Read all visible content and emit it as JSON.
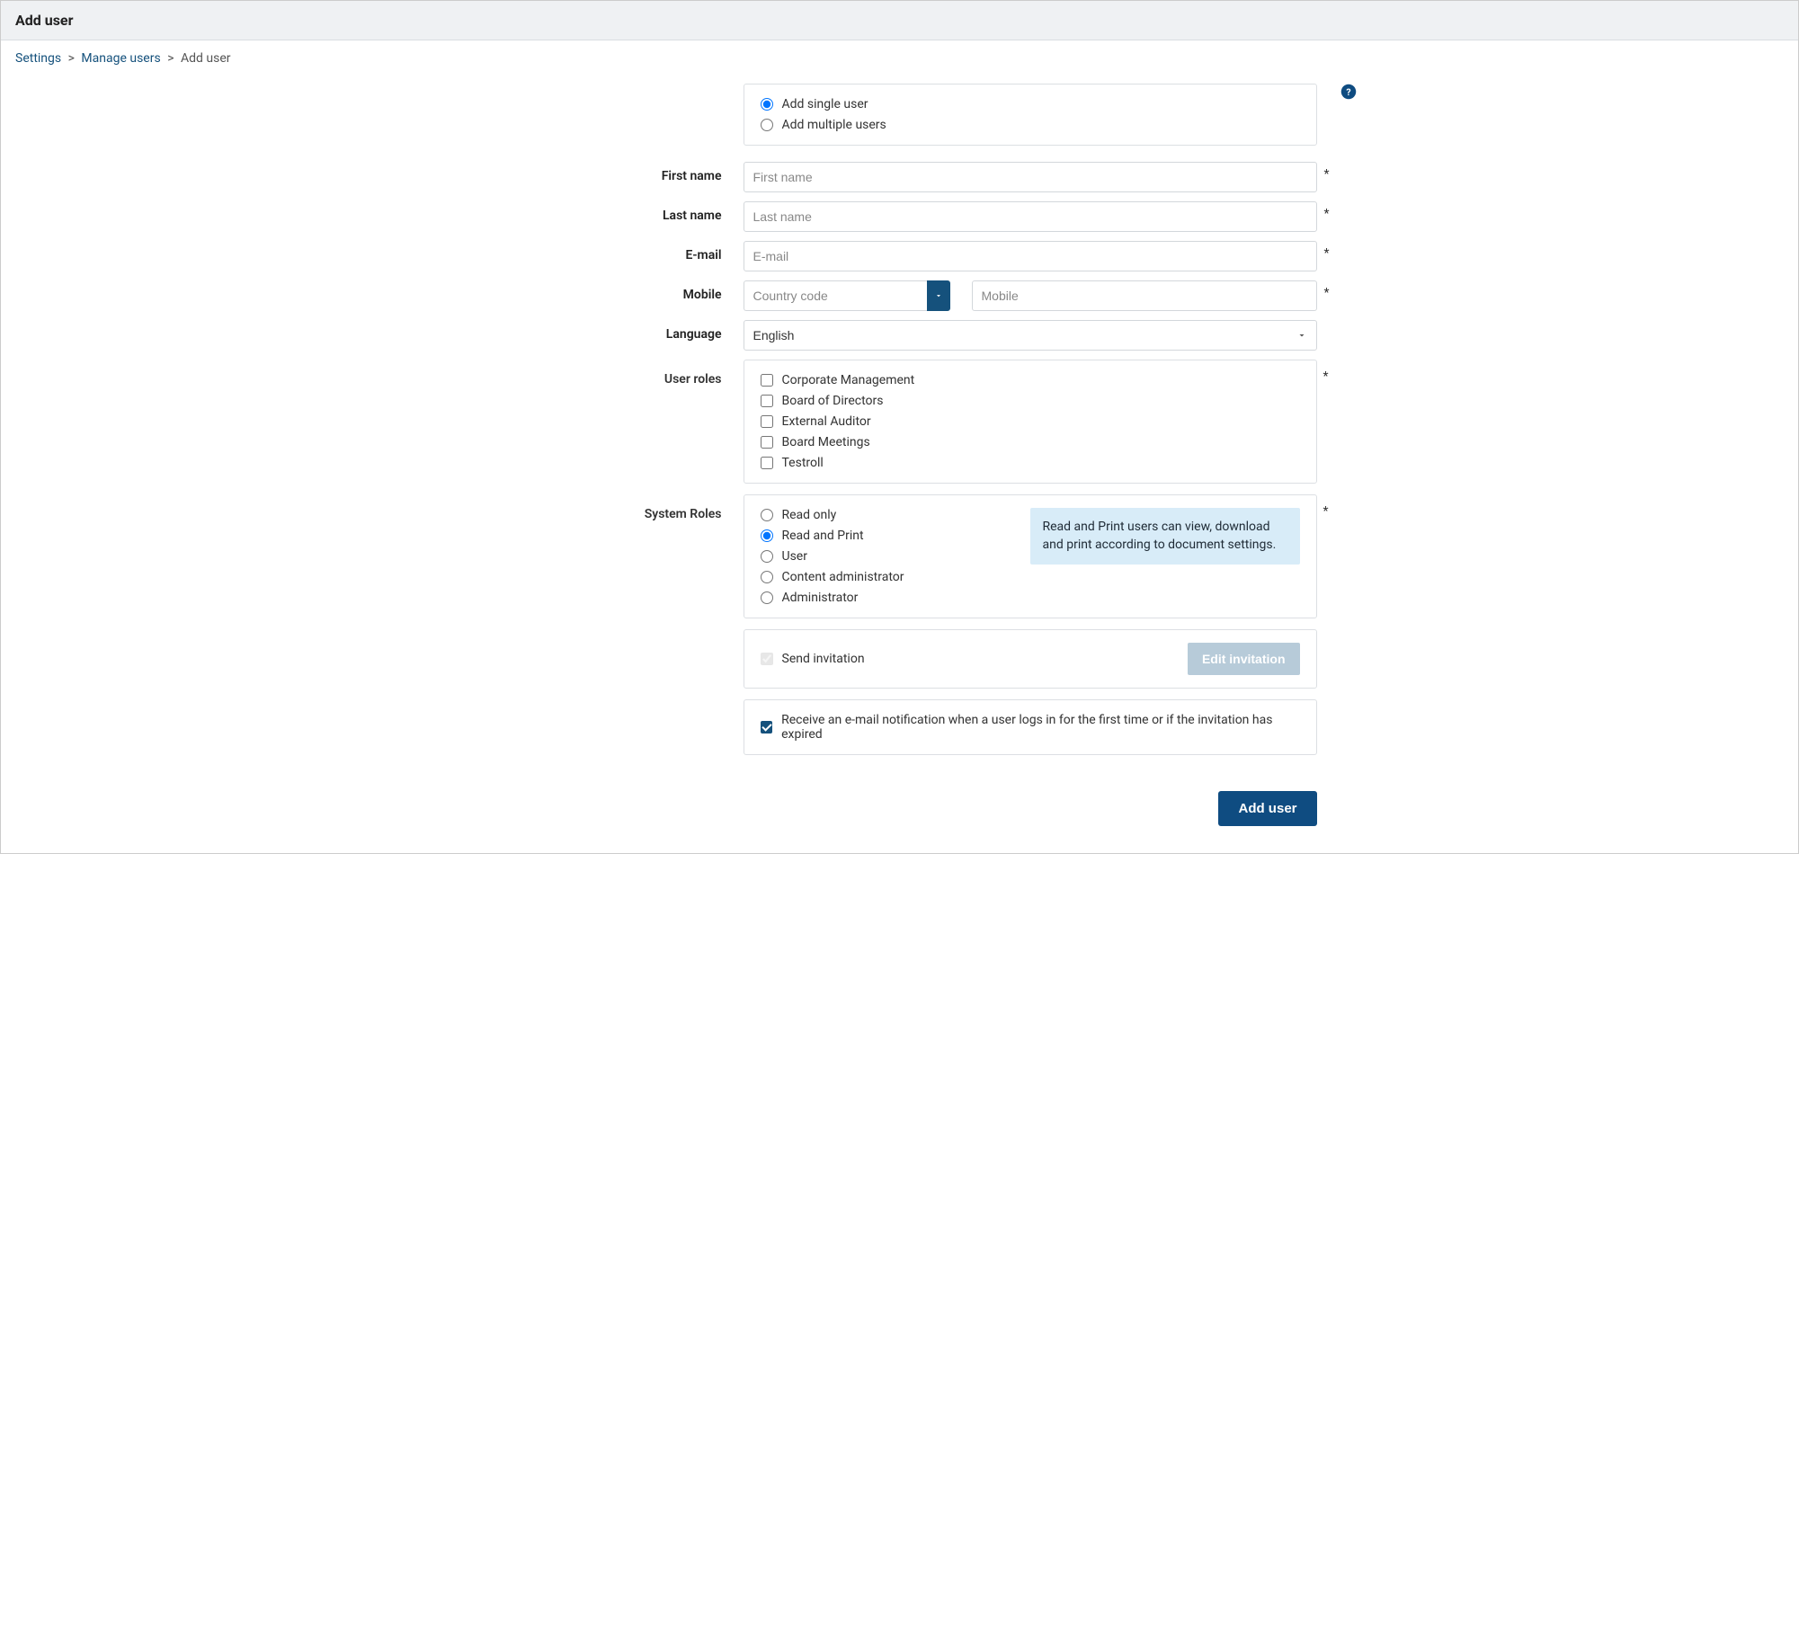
{
  "header": {
    "title": "Add user"
  },
  "breadcrumb": {
    "settings": "Settings",
    "manage_users": "Manage users",
    "current": "Add user"
  },
  "mode": {
    "single": "Add single user",
    "multiple": "Add multiple users"
  },
  "labels": {
    "first_name": "First name",
    "last_name": "Last name",
    "email": "E-mail",
    "mobile": "Mobile",
    "language": "Language",
    "user_roles": "User roles",
    "system_roles": "System Roles"
  },
  "placeholders": {
    "first_name": "First name",
    "last_name": "Last name",
    "email": "E-mail",
    "country_code": "Country code",
    "mobile": "Mobile"
  },
  "language": {
    "selected": "English"
  },
  "user_roles": {
    "items": [
      "Corporate Management",
      "Board of Directors",
      "External Auditor",
      "Board Meetings",
      "Testroll"
    ]
  },
  "system_roles": {
    "items": [
      "Read only",
      "Read and Print",
      "User",
      "Content administrator",
      "Administrator"
    ],
    "hint": "Read and Print users can view, download and print according to document settings."
  },
  "invitation": {
    "send_label": "Send invitation",
    "edit_button": "Edit invitation"
  },
  "notify": {
    "label": "Receive an e-mail notification when a user logs in for the first time or if the invitation has expired"
  },
  "actions": {
    "add_user": "Add user"
  },
  "required_marker": "*"
}
